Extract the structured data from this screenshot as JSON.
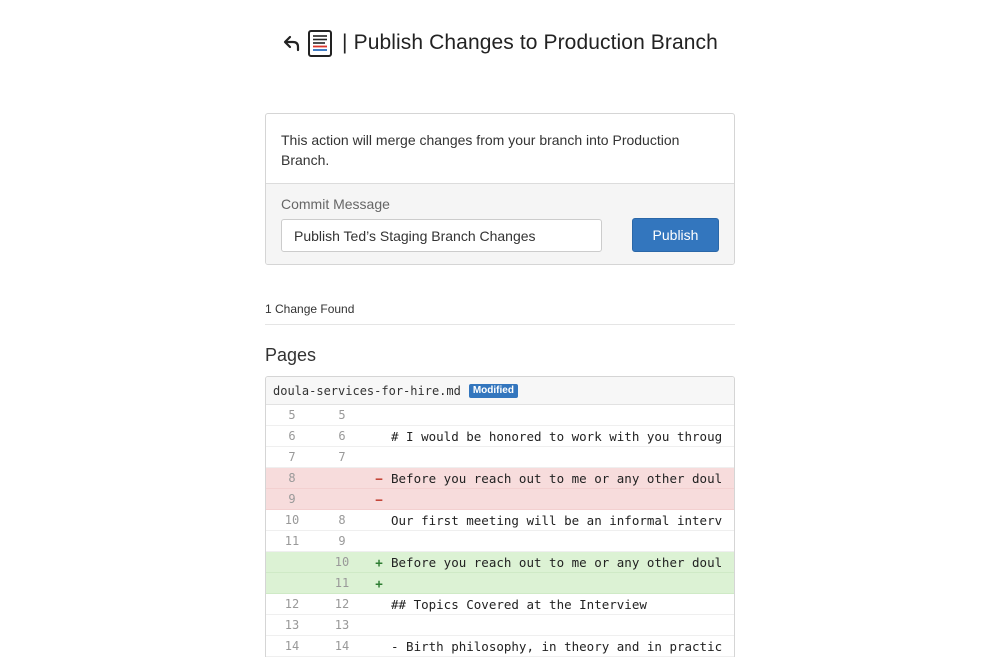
{
  "header": {
    "back_icon": "back-arrow-icon",
    "doc_icon": "document-diff-icon",
    "separator": "|",
    "title": "Publish Changes to Production Branch"
  },
  "card": {
    "info_text": "This action will merge changes from your branch into Production Branch.",
    "commit_label": "Commit Message",
    "commit_value": "Publish Ted’s Staging Branch Changes",
    "publish_label": "Publish"
  },
  "changes": {
    "count_text": "1 Change Found",
    "section_heading": "Pages"
  },
  "diff": {
    "filename": "doula-services-for-hire.md",
    "badge": "Modified",
    "colors": {
      "deleted": "#f7dcdc",
      "added": "#dcf2d4",
      "badge": "#3376be"
    },
    "lines": [
      {
        "old": "5",
        "new": "5",
        "marker": "",
        "type": "context",
        "text": ""
      },
      {
        "old": "6",
        "new": "6",
        "marker": "",
        "type": "context",
        "text": "# I would be honored to work with you throug"
      },
      {
        "old": "7",
        "new": "7",
        "marker": "",
        "type": "context",
        "text": ""
      },
      {
        "old": "8",
        "new": "",
        "marker": "−",
        "type": "del",
        "text": "Before you reach out to me or any other doul"
      },
      {
        "old": "9",
        "new": "",
        "marker": "−",
        "type": "del",
        "text": ""
      },
      {
        "old": "10",
        "new": "8",
        "marker": "",
        "type": "context",
        "text": "Our first meeting will be an informal interv"
      },
      {
        "old": "11",
        "new": "9",
        "marker": "",
        "type": "context",
        "text": ""
      },
      {
        "old": "",
        "new": "10",
        "marker": "+",
        "type": "add",
        "text": "Before you reach out to me or any other doul"
      },
      {
        "old": "",
        "new": "11",
        "marker": "+",
        "type": "add",
        "text": ""
      },
      {
        "old": "12",
        "new": "12",
        "marker": "",
        "type": "context",
        "text": "## Topics Covered at the Interview"
      },
      {
        "old": "13",
        "new": "13",
        "marker": "",
        "type": "context",
        "text": ""
      },
      {
        "old": "14",
        "new": "14",
        "marker": "",
        "type": "context",
        "text": "- Birth philosophy, in theory and in practic"
      }
    ]
  }
}
